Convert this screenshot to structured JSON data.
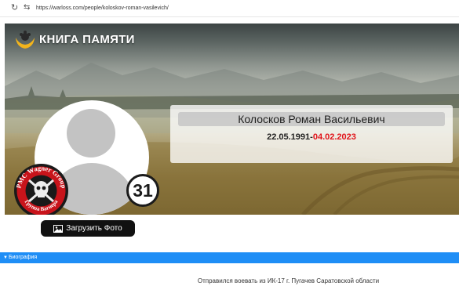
{
  "browser": {
    "reload_icon": "reload-icon",
    "site_info_icon": "site-settings-icon",
    "url": "https://warloss.com/people/koloskov-roman-vasilevich/"
  },
  "brand": {
    "title": "КНИГА ПАМЯТИ",
    "logo_icon": "hands-candle-logo",
    "logo_color": "#f2b41c"
  },
  "person": {
    "name": "Колосков Роман Васильевич",
    "birth_date": "22.05.1991",
    "date_separator": "-",
    "death_date": "04.02.2023",
    "death_date_color": "#e1141b",
    "count": "31",
    "badge_text": "PMC Wagner Group",
    "badge_text_ru": "Группа Вагнера"
  },
  "actions": {
    "upload_photo": "Загрузить Фото",
    "upload_icon": "image-icon"
  },
  "biography": {
    "section_label": "Биография",
    "caret_icon": "chevron-down-icon",
    "accent_color": "#1f8ef6",
    "text": "Отправился воевать из ИК-17 г. Пугачев Саратовской области"
  }
}
